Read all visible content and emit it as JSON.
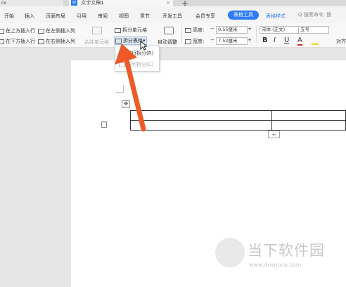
{
  "tabs": {
    "left_tab_label": "cx",
    "doc_tab_icon": "W",
    "doc_tab_label": "文字文稿1",
    "close_glyph": "×",
    "new_tab_glyph": "+"
  },
  "menu": {
    "items": [
      "开始",
      "插入",
      "页面布局",
      "引用",
      "审阅",
      "视图",
      "章节",
      "开发工具",
      "会员专享"
    ],
    "active": "表格工具",
    "next": "表格样式",
    "search_placeholder": "Q 搜索命令, 搜"
  },
  "ribbon": {
    "insert_above": "在上方插入行",
    "insert_left": "在左侧插入列",
    "insert_below": "在下方插入行",
    "insert_right": "在右侧插入列",
    "merge_cells": "合并单元格",
    "split_cells": "拆分单元格",
    "split_table": "拆分表格",
    "split_table_arrow": "▾",
    "auto_fit": "自动调整",
    "height_label": "高度:",
    "height_value": "0.55厘米",
    "width_label": "宽度:",
    "width_value": "7.52厘米",
    "minus": "−",
    "plus": "+",
    "font_name": "宋体 (正文)",
    "font_size": "五号",
    "bold": "B",
    "italic": "I",
    "underline": "U",
    "font_color": "A",
    "align": "对齐"
  },
  "dropdown": {
    "split_by_row": "按行拆分(R)",
    "split_by_col": "按列拆分(C)"
  },
  "table": {
    "add_row_glyph": "+",
    "move_handle_glyph": "✥"
  },
  "watermark": {
    "brand": "当下软件园",
    "url": "www.downxia.com"
  },
  "colors": {
    "accent": "#2f7cf6",
    "arrow": "#ee5a28"
  }
}
